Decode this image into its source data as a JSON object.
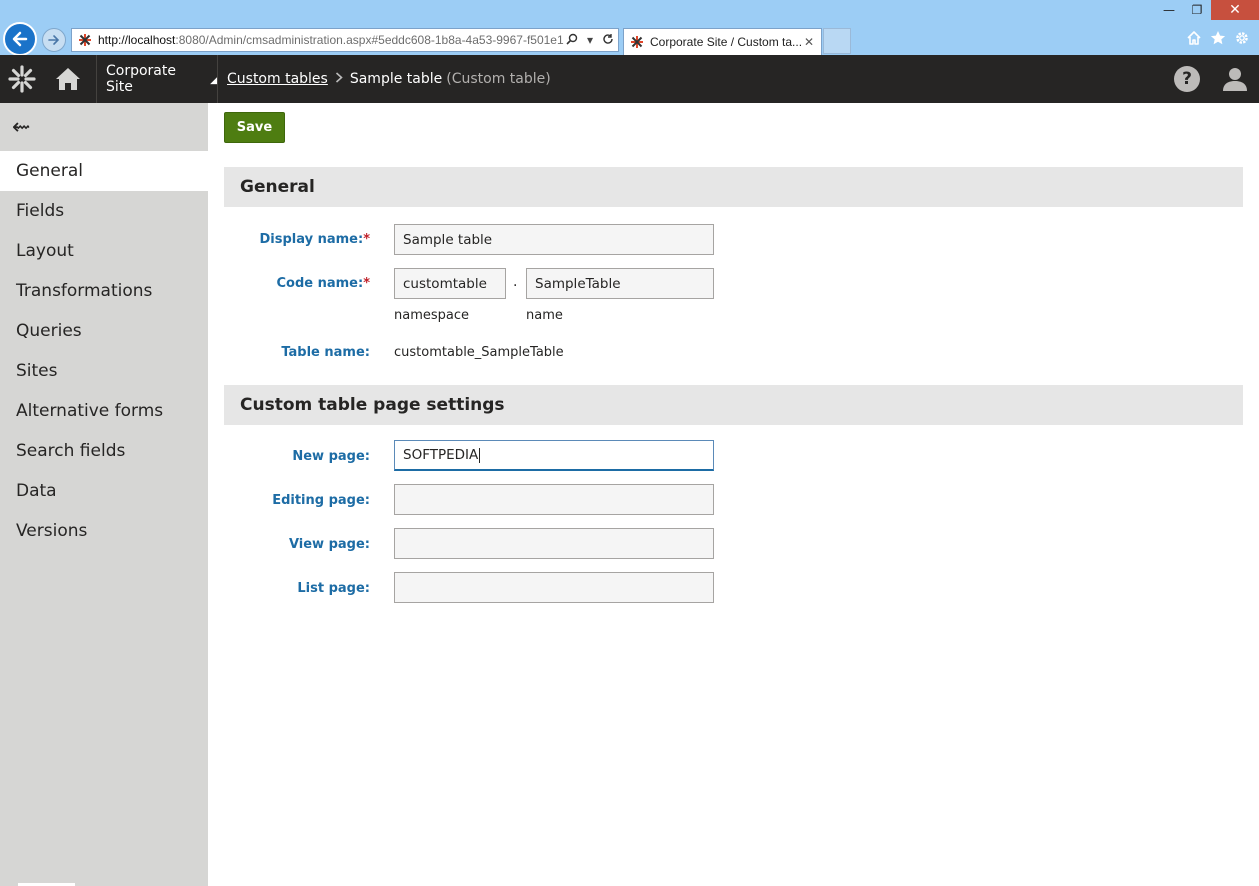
{
  "browser": {
    "url_host": "http://localhost",
    "url_rest": ":8080/Admin/cmsadministration.aspx#5eddc608-1b8a-4a53-9967-f501e1",
    "tab_title": "Corporate Site / Custom ta...",
    "tab_close": "✕",
    "window_controls": {
      "minimize": "—",
      "restore": "❐",
      "close": "✕"
    }
  },
  "header": {
    "site_selector": "Corporate Site",
    "breadcrumb": {
      "parent": "Custom tables",
      "current": "Sample table",
      "type": "(Custom table)"
    },
    "help": "?"
  },
  "sidebar": {
    "back": "⇜",
    "items": [
      {
        "label": "General",
        "active": true
      },
      {
        "label": "Fields"
      },
      {
        "label": "Layout"
      },
      {
        "label": "Transformations"
      },
      {
        "label": "Queries"
      },
      {
        "label": "Sites"
      },
      {
        "label": "Alternative forms"
      },
      {
        "label": "Search fields"
      },
      {
        "label": "Data"
      },
      {
        "label": "Versions"
      }
    ]
  },
  "toolbar": {
    "save_label": "Save"
  },
  "general": {
    "title": "General",
    "display_name_label": "Display name:",
    "display_name_value": "Sample table",
    "code_name_label": "Code name:",
    "required_mark": "*",
    "namespace_value": "customtable",
    "name_value": "SampleTable",
    "separator": ".",
    "namespace_caption": "namespace",
    "name_caption": "name",
    "table_name_label": "Table name:",
    "table_name_value": "customtable_SampleTable"
  },
  "page_settings": {
    "title": "Custom table page settings",
    "new_page_label": "New page:",
    "new_page_value": "SOFTPEDIA",
    "editing_page_label": "Editing page:",
    "editing_page_value": "",
    "view_page_label": "View page:",
    "view_page_value": "",
    "list_page_label": "List page:",
    "list_page_value": ""
  },
  "colors": {
    "header_bg": "#262524",
    "sidebar_bg": "#d6d6d4",
    "label_blue": "#1d6ca5",
    "save_green": "#4e7d11",
    "required_red": "#c0212a",
    "browser_frame": "#9ccdf5"
  }
}
